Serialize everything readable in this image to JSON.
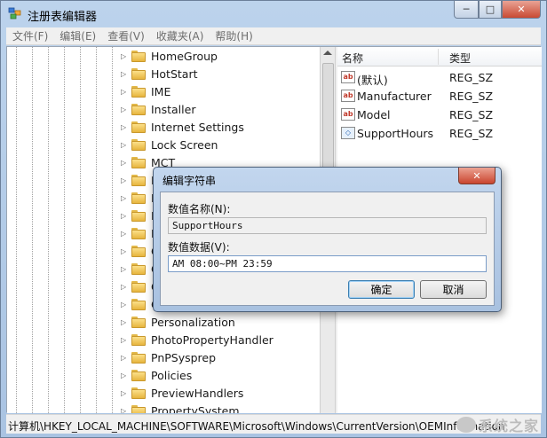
{
  "window": {
    "title": "注册表编辑器"
  },
  "menu": [
    "文件(F)",
    "编辑(E)",
    "查看(V)",
    "收藏夹(A)",
    "帮助(H)"
  ],
  "tree": {
    "items": [
      "HomeGroup",
      "HotStart",
      "IME",
      "Installer",
      "Internet Settings",
      "Lock Screen",
      "MCT",
      "M",
      "M",
      "M",
      "N",
      "O",
      "O",
      "O",
      "O",
      "Personalization",
      "PhotoPropertyHandler",
      "PnPSysprep",
      "Policies",
      "PreviewHandlers",
      "PropertySystem"
    ]
  },
  "list": {
    "col_name": "名称",
    "col_type": "类型",
    "rows": [
      {
        "name": "(默认)",
        "type": "REG_SZ",
        "icon": "string-value-icon"
      },
      {
        "name": "Manufacturer",
        "type": "REG_SZ",
        "icon": "string-value-icon"
      },
      {
        "name": "Model",
        "type": "REG_SZ",
        "icon": "string-value-icon"
      },
      {
        "name": "SupportHours",
        "type": "REG_SZ",
        "icon": "binary-value-icon"
      }
    ]
  },
  "status": {
    "path": "计算机\\HKEY_LOCAL_MACHINE\\SOFTWARE\\Microsoft\\Windows\\CurrentVersion\\OEMInformation"
  },
  "dialog": {
    "title": "编辑字符串",
    "name_label": "数值名称(N):",
    "name_value": "SupportHours",
    "data_label": "数值数据(V):",
    "data_value": "AM 08:00~PM 23:59",
    "ok": "确定",
    "cancel": "取消"
  },
  "watermark": {
    "text": "系统之家"
  }
}
